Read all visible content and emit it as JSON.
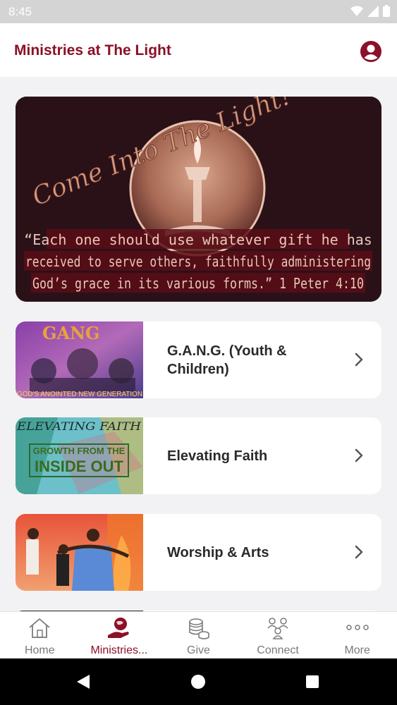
{
  "status_bar": {
    "time": "8:45"
  },
  "app_bar": {
    "title": "Ministries at The Light"
  },
  "hero": {
    "script_text": "Come Into The Light!",
    "quote_lines": [
      "“Each one should use whatever gift he has",
      "received to serve others, faithfully administering",
      "God’s grace in its various forms.” 1 Peter 4:10"
    ]
  },
  "ministries": [
    {
      "label": "G.A.N.G. (Youth & Children)",
      "thumb_title": "GANG",
      "thumb_caption": "GOD'S ANOINTED NEW GENERATION"
    },
    {
      "label": "Elevating Faith",
      "thumb_title": "ELEVATING FAITH",
      "thumb_sub1": "GROWTH FROM THE",
      "thumb_sub2": "INSIDE OUT"
    },
    {
      "label": "Worship & Arts"
    }
  ],
  "tabs": [
    {
      "label": "Home",
      "icon": "home-icon"
    },
    {
      "label": "Ministries...",
      "icon": "ministries-icon"
    },
    {
      "label": "Give",
      "icon": "coins-icon"
    },
    {
      "label": "Connect",
      "icon": "people-icon"
    },
    {
      "label": "More",
      "icon": "more-dots-icon"
    }
  ],
  "colors": {
    "brand": "#8b1028",
    "hero_bg": "#2a1118",
    "inactive": "#7a7a7a"
  }
}
